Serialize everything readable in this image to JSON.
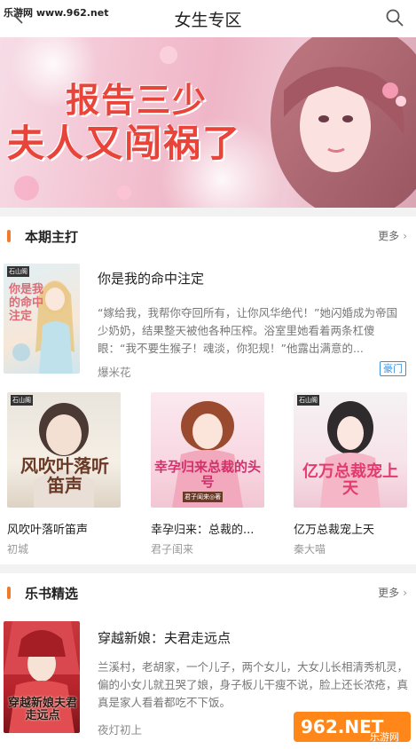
{
  "header": {
    "watermark": "乐游网 www.962.net",
    "title": "女生专区"
  },
  "banner": {
    "line1": "报告三少",
    "line2": "夫人又闯祸了"
  },
  "section1": {
    "title": "本期主打",
    "more": "更多",
    "featured": {
      "cover_text": "你是我的命中注定",
      "publisher": "石山阁",
      "title": "你是我的命中注定",
      "desc": "“嫁给我，我帮你夺回所有，让你风华绝代！”她闪婚成为帝国少奶奶，结果整天被他各种压榨。浴室里她看着两条杠傻眼：“我不要生猴子！魂淡，你犯规！”他露出满意的...",
      "author": "爆米花",
      "tag": "豪门"
    },
    "grid": [
      {
        "title": "风吹叶落听笛声",
        "author": "初城",
        "cover_text": "风吹叶落听笛声",
        "publisher": "石山阁"
      },
      {
        "title": "幸孕归来：总裁的...",
        "author": "君子闺来",
        "cover_text": "幸孕归来总裁的头号",
        "publisher": "君子闺来◎著"
      },
      {
        "title": "亿万总裁宠上天",
        "author": "秦大喵",
        "cover_text": "亿万总裁宠上天",
        "publisher": "石山阁"
      }
    ]
  },
  "section2": {
    "title": "乐书精选",
    "more": "更多",
    "featured": {
      "cover_text": "穿越新娘夫君走远点",
      "title": "穿越新娘：夫君走远点",
      "desc": "兰溪村，老胡家，一个儿子，两个女儿，大女儿长相清秀机灵，偏的小女儿就丑哭了娘，身子板儿干瘦不说，脸上还长浓疮，真真是家人看着都吃不下饭。",
      "author": "夜灯初上"
    }
  },
  "logo": {
    "text": "962.NET",
    "sub": "乐游网"
  },
  "colors": {
    "accent": "#f27a2c",
    "tag": "#3b8fd9",
    "banner_text": "#e8443a"
  }
}
